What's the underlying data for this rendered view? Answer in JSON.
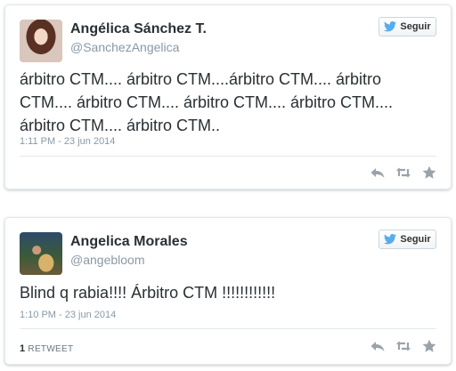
{
  "colors": {
    "text": "#292f33",
    "muted": "#8899a6",
    "border": "#e1e8ed",
    "bird_blue": "#55acee",
    "action_gray": "#9aa3aa"
  },
  "tweets": [
    {
      "author_name": "Angélica Sánchez T.",
      "handle": "@SanchezAngelica",
      "follow_label": "Seguir",
      "text": "árbitro CTM.... árbitro CTM....árbitro CTM.... árbitro CTM.... árbitro CTM.... árbitro CTM.... árbitro CTM.... árbitro CTM.... árbitro CTM..",
      "timestamp": "1:11 PM - 23 jun 2014",
      "actions": [
        "reply-icon",
        "retweet-icon",
        "favorite-icon"
      ]
    },
    {
      "author_name": "Angelica Morales",
      "handle": "@angebloom",
      "follow_label": "Seguir",
      "text": "Blind q rabia!!!! Árbitro CTM !!!!!!!!!!!!",
      "timestamp": "1:10 PM - 23 jun 2014",
      "retweet_count": "1",
      "retweet_label": "RETWEET",
      "actions": [
        "reply-icon",
        "retweet-icon",
        "favorite-icon"
      ]
    }
  ]
}
